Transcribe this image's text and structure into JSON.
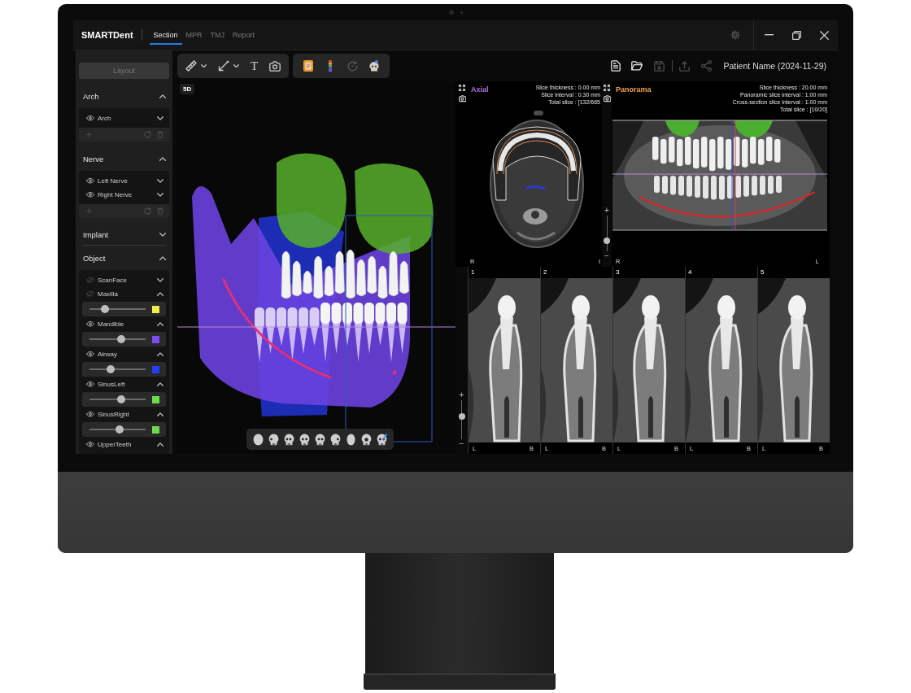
{
  "titlebar": {
    "logo": "SMARTDent",
    "tabs": [
      {
        "label": "Section",
        "selected": true
      },
      {
        "label": "MPR",
        "selected": false
      },
      {
        "label": "TMJ",
        "selected": false
      },
      {
        "label": "Report",
        "selected": false
      }
    ]
  },
  "toolbar": {
    "measure_tools": [
      {
        "kind": "ruler",
        "dropdown": true
      },
      {
        "kind": "arrow",
        "dropdown": true
      },
      {
        "kind": "text",
        "glyph": "T",
        "dropdown": false
      },
      {
        "kind": "camera",
        "dropdown": false
      }
    ],
    "view_tools": [
      {
        "kind": "report",
        "disabled": false
      },
      {
        "kind": "color-bar",
        "disabled": false
      },
      {
        "kind": "rotate",
        "disabled": true
      },
      {
        "kind": "skull",
        "disabled": false
      }
    ],
    "file_actions": [
      {
        "kind": "document",
        "disabled": false
      },
      {
        "kind": "folder",
        "disabled": false
      },
      {
        "kind": "save",
        "disabled": true
      }
    ],
    "share_actions": [
      {
        "kind": "upload",
        "disabled": true
      },
      {
        "kind": "share",
        "disabled": true
      }
    ],
    "patient": "Patient Name (2024-11-29)"
  },
  "sidebar": {
    "layout_button": {
      "label": "Layout",
      "disabled": true
    },
    "sections": [
      {
        "title": "Arch",
        "expanded": true,
        "footer_tools": true,
        "items": [
          {
            "name": "Arch",
            "visible": true,
            "expanded": false
          }
        ]
      },
      {
        "title": "Nerve",
        "expanded": true,
        "footer_tools": true,
        "items": [
          {
            "name": "Left Nerve",
            "visible": true,
            "expanded": false
          },
          {
            "name": "Right Nerve",
            "visible": true,
            "expanded": false
          }
        ]
      },
      {
        "title": "Implant",
        "expanded": false
      },
      {
        "title": "Object",
        "expanded": true,
        "items": [
          {
            "name": "ScanFace",
            "visible": false,
            "expanded": false
          },
          {
            "name": "Maxilla",
            "visible": false,
            "expanded": true,
            "level": 0.27,
            "color": "#f2ec48"
          },
          {
            "name": "Mandible",
            "visible": true,
            "expanded": true,
            "level": 0.56,
            "color": "#7a4cf2"
          },
          {
            "name": "Airway",
            "visible": true,
            "expanded": true,
            "level": 0.38,
            "color": "#2140f0"
          },
          {
            "name": "SinusLeft",
            "visible": true,
            "expanded": true,
            "level": 0.56,
            "color": "#6cdc4c"
          },
          {
            "name": "SinusRight",
            "visible": true,
            "expanded": true,
            "level": 0.53,
            "color": "#6cdc4c"
          },
          {
            "name": "UpperTeeth",
            "visible": true,
            "expanded": true
          }
        ]
      }
    ]
  },
  "view_3d": {
    "label": "5D"
  },
  "axial": {
    "title": "Axial",
    "info": [
      "Slice thickness : 0.00 mm",
      "Slice interval : 0.30 mm",
      "Total slice : [132/665"
    ],
    "left_label": "R",
    "right_label": "I",
    "slider": {
      "plus": "+",
      "minus": "−",
      "level": 0.3
    }
  },
  "panorama": {
    "title": "Panorama",
    "info": [
      "Slice thickness : 20.00 mm",
      "Panoramic slice interval : 1.00 mm",
      "Cross-section slice interval : 1.00 mm",
      "Total slice : [10/20]"
    ],
    "left_label": "R",
    "right_label": "L"
  },
  "cross_sections": {
    "slider": {
      "plus": "+",
      "minus": "−",
      "level": 0.58
    },
    "panels": [
      {
        "number": "1",
        "left_label": "L",
        "right_label": "B"
      },
      {
        "number": "2",
        "left_label": "L",
        "right_label": "B"
      },
      {
        "number": "3",
        "left_label": "L",
        "right_label": "B"
      },
      {
        "number": "4",
        "left_label": "L",
        "right_label": "B"
      },
      {
        "number": "5",
        "left_label": "L",
        "right_label": "B"
      }
    ]
  }
}
